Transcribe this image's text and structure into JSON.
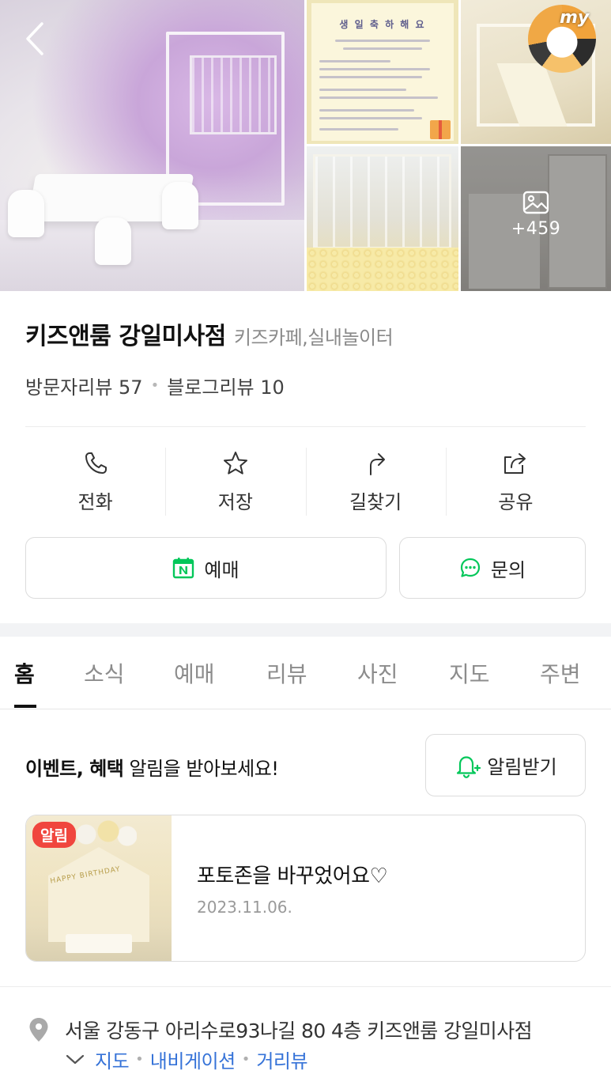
{
  "gallery": {
    "more_count": "+459",
    "my_badge": "my",
    "poster_title": "생 일 축 하 해 요",
    "photo_labels": [
      "main-photo",
      "birthday-poster-photo",
      "slide-photo",
      "ball-pit-photo",
      "kitchen-photo"
    ]
  },
  "place": {
    "name": "키즈앤룸 강일미사점",
    "category": "키즈카페,실내놀이터",
    "visitor_reviews": "방문자리뷰 57",
    "blog_reviews": "블로그리뷰 10"
  },
  "actions": [
    {
      "label": "전화",
      "icon": "phone-icon"
    },
    {
      "label": "저장",
      "icon": "star-icon"
    },
    {
      "label": "길찾기",
      "icon": "directions-icon"
    },
    {
      "label": "공유",
      "icon": "share-icon"
    }
  ],
  "buttons": {
    "reserve": "예매",
    "inquire": "문의",
    "alert": "알림받기"
  },
  "tabs": [
    "홈",
    "소식",
    "예매",
    "리뷰",
    "사진",
    "지도",
    "주변"
  ],
  "active_tab": "홈",
  "notice": {
    "bold": "이벤트, 혜택",
    "rest": " 알림을 받아보세요!"
  },
  "news": {
    "badge": "알림",
    "title": "포토존을 바꾸었어요♡",
    "date": "2023.11.06.",
    "thumb_banner": "HAPPY BIRTHDAY"
  },
  "address": {
    "text": "서울 강동구 아리수로93나길 80 4층 키즈앤룸 강일미사점",
    "links": [
      "지도",
      "내비게이션",
      "거리뷰"
    ]
  },
  "colors": {
    "naver_green": "#03c75a",
    "link_blue": "#3673d8",
    "badge_red": "#f0463e"
  }
}
